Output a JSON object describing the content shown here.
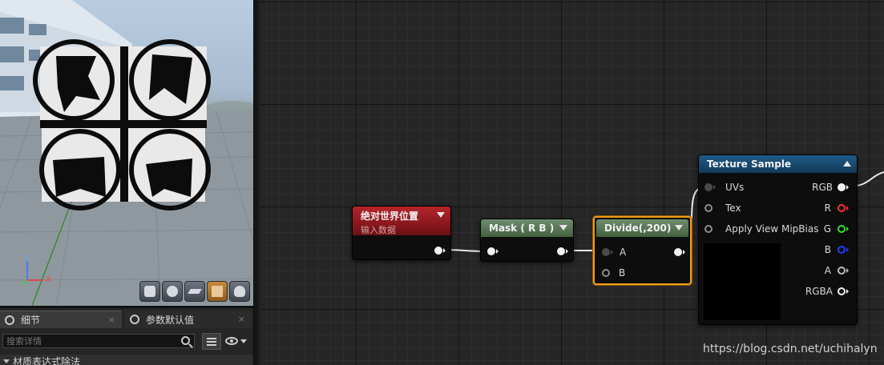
{
  "details_panel": {
    "tab_details": "细节",
    "tab_params": "参数默认值",
    "tab_close_glyph": "×",
    "search_placeholder": "搜索详情",
    "section_header": "材质表达式除法"
  },
  "viewport": {
    "axis_labels": {
      "z": "Z",
      "x": "X"
    },
    "preview_buttons": [
      "cylinder-icon",
      "sphere-icon",
      "plane-icon",
      "cube-icon",
      "teapot-icon"
    ],
    "active_preview": "cube-icon"
  },
  "graph": {
    "nodes": {
      "world_position": {
        "title": "绝对世界位置",
        "subtitle": "输入数据"
      },
      "mask": {
        "title": "Mask ( R B )"
      },
      "divide": {
        "title": "Divide(,200)",
        "pin_a": "A",
        "pin_b": "B"
      },
      "texture_sample": {
        "title": "Texture Sample",
        "inputs": [
          "UVs",
          "Tex",
          "Apply View MipBias"
        ],
        "outputs": [
          "RGB",
          "R",
          "G",
          "B",
          "A",
          "RGBA"
        ]
      }
    },
    "output_pin_colors": {
      "RGB": "#f2f2f2",
      "R": "#ff3030",
      "G": "#30e030",
      "B": "#2040ff",
      "A": "#bdbdbd",
      "RGBA": "#f2f2f2"
    },
    "accent_selected": "#f39c12"
  },
  "watermark": "https://blog.csdn.net/uchihalyn"
}
